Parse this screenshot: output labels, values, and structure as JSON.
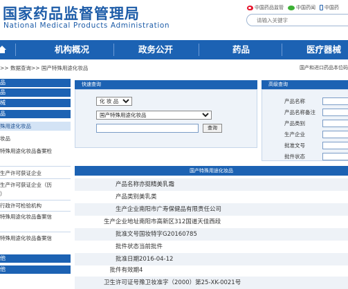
{
  "header": {
    "title_cn": "国家药品监督管理局",
    "title_en": "National Medical Products Administration",
    "top_links": [
      {
        "label": "中国药品监管",
        "icon": "weibo-icon"
      },
      {
        "label": "中国药闻",
        "icon": "wechat-icon"
      },
      {
        "label": "中国药",
        "icon": "mobile-icon"
      }
    ],
    "search_placeholder": "请输入关键字"
  },
  "nav": {
    "items": [
      "机构概况",
      "政务公开",
      "药品",
      "医疗器械"
    ]
  },
  "breadcrumb": {
    "left": ">> 数据查询>> 国产特殊用途化妆品",
    "right": "国产和进口药品本位码"
  },
  "sidebar": {
    "items": [
      {
        "label": "品",
        "type": "head"
      },
      {
        "label": "品",
        "type": "head"
      },
      {
        "label": "械",
        "type": "head"
      },
      {
        "label": "品",
        "type": "head"
      },
      {
        "label": "殊用途化妆品",
        "type": "active"
      },
      {
        "label": "妆品",
        "type": "item"
      },
      {
        "label": "特殊用途化妆品备案检",
        "type": "item"
      },
      {
        "label": "",
        "type": "item"
      },
      {
        "label": "生产许可获证企业",
        "type": "item"
      },
      {
        "label": "生产许可获证企业（历",
        "type": "item"
      },
      {
        "label": "）",
        "type": "item"
      },
      {
        "label": "行政许可检验机构",
        "type": "item"
      },
      {
        "label": "特殊用途化妆品备案信",
        "type": "item"
      },
      {
        "label": "",
        "type": "item"
      },
      {
        "label": "特殊用途化妆品备案信",
        "type": "item"
      },
      {
        "label": "他",
        "type": "head"
      },
      {
        "label": "他",
        "type": "head"
      }
    ]
  },
  "quick_search": {
    "title": "快速查询",
    "category": "化 妆 品",
    "subcategory": "国产特殊用途化妆品",
    "query_value": "",
    "button_label": "查询"
  },
  "advanced_search": {
    "title": "高级查询",
    "fields": [
      "产品名称",
      "产品名称备注",
      "产品类别",
      "生产企业",
      "批准文号",
      "批件状态"
    ]
  },
  "detail": {
    "title": "国产特殊用途化妆品",
    "rows": [
      {
        "key": "产品名称",
        "value": "亦挺精美乳霜"
      },
      {
        "key": "产品类别",
        "value": "美乳类"
      },
      {
        "key": "生产企业",
        "value": "南阳市广寿保健品有限责任公司"
      },
      {
        "key": "生产企业地址",
        "value": "南阳市高新区312国道天佳西段"
      },
      {
        "key": "批准文号",
        "value": "国妆特字G20160785"
      },
      {
        "key": "批件状态",
        "value": "当前批件"
      },
      {
        "key": "批准日期",
        "value": "2016-04-12"
      },
      {
        "key": "批件有效期",
        "value": "4"
      },
      {
        "key": "卫生许可证号",
        "value": "豫卫妆准字（2000）第25-XK-0021号"
      }
    ]
  },
  "colors": {
    "brand_blue": "#1c62b3",
    "logo_blue": "#1d5ca8",
    "row_shade": "#eef2f7"
  }
}
